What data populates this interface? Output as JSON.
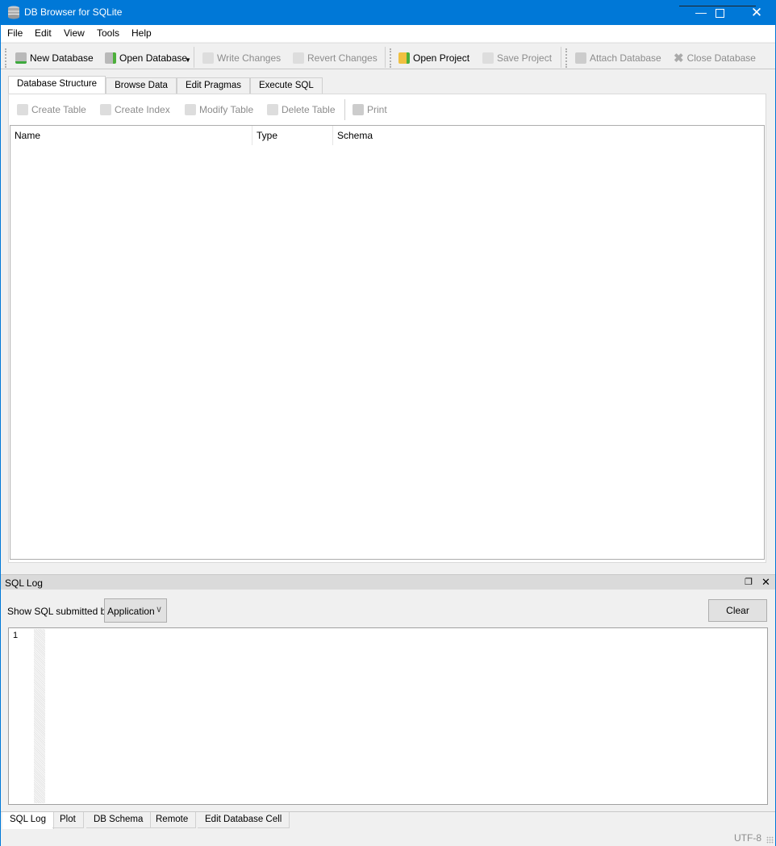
{
  "window": {
    "title": "DB Browser for SQLite",
    "accent": "#0078d7"
  },
  "menu": [
    "File",
    "Edit",
    "View",
    "Tools",
    "Help"
  ],
  "toolbar": {
    "new_database": "New Database",
    "open_database": "Open Database",
    "write_changes": "Write Changes",
    "revert_changes": "Revert Changes",
    "open_project": "Open Project",
    "save_project": "Save Project",
    "attach_database": "Attach Database",
    "close_database": "Close Database"
  },
  "tabs": [
    "Database Structure",
    "Browse Data",
    "Edit Pragmas",
    "Execute SQL"
  ],
  "structure_toolbar": {
    "create_table": "Create Table",
    "create_index": "Create Index",
    "modify_table": "Modify Table",
    "delete_table": "Delete Table",
    "print": "Print"
  },
  "tree": {
    "columns": [
      "Name",
      "Type",
      "Schema"
    ]
  },
  "sql_log": {
    "title": "SQL Log",
    "show_label": "Show SQL submitted by",
    "submitter": "Application",
    "clear": "Clear",
    "line_number": "1"
  },
  "bottom_tabs": [
    "SQL Log",
    "Plot",
    "DB Schema",
    "Remote",
    "Edit Database Cell"
  ],
  "status": {
    "encoding": "UTF-8"
  }
}
